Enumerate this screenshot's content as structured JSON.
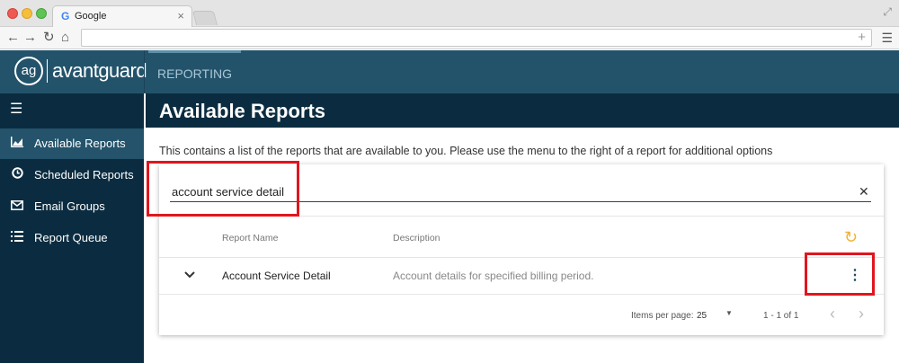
{
  "browser": {
    "tab_title": "Google",
    "favicon": "G",
    "address_value": ""
  },
  "app": {
    "logo_text": "ag",
    "brand": "avantguard",
    "top_nav_tab": "REPORTING"
  },
  "sidebar": {
    "items": [
      {
        "label": "Available Reports",
        "icon": "bar-chart-icon",
        "active": true
      },
      {
        "label": "Scheduled Reports",
        "icon": "clock-icon",
        "active": false
      },
      {
        "label": "Email Groups",
        "icon": "envelope-icon",
        "active": false
      },
      {
        "label": "Report Queue",
        "icon": "list-icon",
        "active": false
      }
    ]
  },
  "main": {
    "title": "Available Reports",
    "subtitle": "This contains a list of the reports that are available to you. Please use the menu to the right of a report for additional options",
    "search": {
      "value": "account service detail",
      "placeholder": ""
    },
    "table": {
      "columns": [
        "Report Name",
        "Description"
      ],
      "rows": [
        {
          "name": "Account Service Detail",
          "description": "Account details for specified billing period."
        }
      ]
    },
    "pagination": {
      "items_per_page_label": "Items per page:",
      "items_per_page": "25",
      "range": "1 - 1 of 1"
    }
  },
  "colors": {
    "header": "#23536b",
    "sidebar": "#0b2c40",
    "accent_refresh": "#f0b232",
    "highlight": "#e0161e"
  }
}
